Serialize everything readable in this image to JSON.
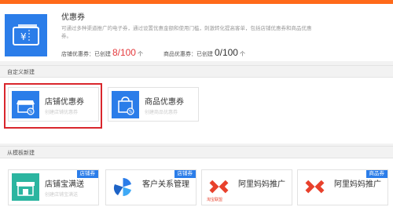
{
  "header": {
    "title": "优惠券",
    "description": "可通过多种渠道推广的电子券，通过设置优惠金额和使用门槛，刺激转化提高客单，包括店铺优惠券和商品优惠券。",
    "shop_stat_label": "店铺优惠券：已创建",
    "shop_stat_value": "8/100",
    "goods_stat_label": "商品优惠券：已创建",
    "goods_stat_value": "0/100",
    "unit": "个"
  },
  "custom_section": {
    "title": "自定义新建",
    "cards": [
      {
        "label": "店铺优惠券",
        "sub": "创建店铺优惠券"
      },
      {
        "label": "商品优惠券",
        "sub": "创建商品优惠券"
      }
    ]
  },
  "template_section": {
    "title": "从模板新建",
    "cards": [
      {
        "label": "店铺宝满送",
        "sub": "创建店铺宝满送",
        "badge": "店铺券"
      },
      {
        "label": "客户关系管理",
        "sub": "",
        "badge": "店铺券"
      },
      {
        "label": "阿里妈妈推广",
        "sub": "",
        "badge": "",
        "logo_text": "淘宝联盟"
      },
      {
        "label": "阿里妈妈推广",
        "sub": "",
        "badge": "商品券"
      }
    ]
  },
  "colors": {
    "accent": "#2b7de9",
    "highlight": "#d9262c",
    "count": "#e4393c",
    "top_strip": "#ff6a1a"
  },
  "icons": [
    "coupon-icon",
    "shop-coupon-icon",
    "goods-coupon-icon",
    "shop-icon",
    "crm-icon",
    "alimama-logo-icon"
  ]
}
